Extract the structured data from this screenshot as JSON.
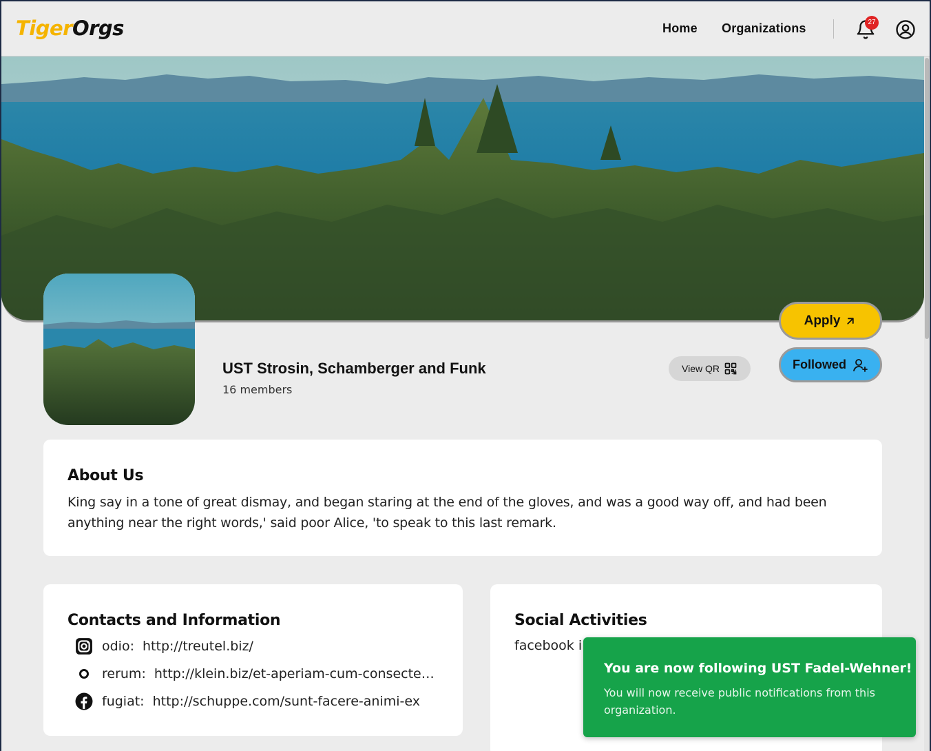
{
  "header": {
    "logo_part1": "Tiger",
    "logo_part2": "Orgs",
    "nav": [
      {
        "label": "Home"
      },
      {
        "label": "Organizations"
      }
    ],
    "notification_count": "27"
  },
  "organization": {
    "name": "UST Strosin, Schamberger and Funk",
    "members": "16 members",
    "view_qr_label": "View QR",
    "apply_label": "Apply",
    "followed_label": "Followed"
  },
  "about": {
    "title": "About Us",
    "text": "King say in a tone of great dismay, and began staring at the end of the gloves, and was a good way off, and had been anything near the right words,' said poor Alice, 'to speak to this last remark."
  },
  "contacts": {
    "title": "Contacts and Information",
    "items": [
      {
        "icon": "instagram-icon",
        "name": "odio:",
        "url": "http://treutel.biz/"
      },
      {
        "icon": "circle-icon",
        "name": "rerum:",
        "url": "http://klein.biz/et-aperiam-cum-consectetu..."
      },
      {
        "icon": "facebook-icon",
        "name": "fugiat:",
        "url": "http://schuppe.com/sunt-facere-animi-ex"
      }
    ]
  },
  "social": {
    "title": "Social Activities",
    "text": "facebook i"
  },
  "toast": {
    "title": "You are now following UST Fadel-Wehner!",
    "body": "You will now receive public notifications from this organization."
  },
  "colors": {
    "brand_yellow": "#f5b400",
    "apply_bg": "#f7c300",
    "followed_bg": "#39b1f0",
    "toast_bg": "#16a34a",
    "badge_bg": "#e02424",
    "page_bg": "#ececec"
  }
}
